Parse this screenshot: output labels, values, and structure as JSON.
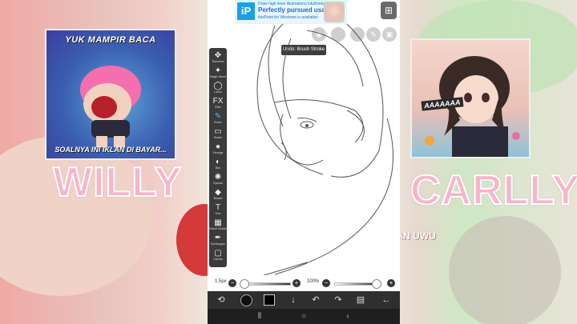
{
  "left_card": {
    "top_text": "YUK MAMPIR BACA",
    "bottom_text": "SOALNYA INI IKLAN DI BAYAR..."
  },
  "right_card": {
    "shout_text": "AAAAAAA"
  },
  "names": {
    "left": "WILLY",
    "right": "CARLLY"
  },
  "watermark": "@MUICAN UWU",
  "ad": {
    "logo_text": "iP",
    "line1": "Draw high level illustrations intuitively!",
    "line2": "Perfectly pursued usability!",
    "line3": "ibisPaint for Windows is available!"
  },
  "tooltip": "Undo: Brush Stroke",
  "tools": [
    {
      "icon": "✥",
      "label": "Transform"
    },
    {
      "icon": "✦",
      "label": "Magic Wand"
    },
    {
      "icon": "◯",
      "label": "Lasso"
    },
    {
      "icon": "FX",
      "label": "Filter"
    },
    {
      "icon": "✎",
      "label": "Brush"
    },
    {
      "icon": "▭",
      "label": "Eraser"
    },
    {
      "icon": "●",
      "label": "Smudge"
    },
    {
      "icon": "◐",
      "label": "Blur"
    },
    {
      "icon": "✺",
      "label": "Special"
    },
    {
      "icon": "◆",
      "label": "Bucket"
    },
    {
      "icon": "T",
      "label": "Text"
    },
    {
      "icon": "▦",
      "label": "Frame Divider"
    },
    {
      "icon": "✒",
      "label": "Eyedropper"
    },
    {
      "icon": "▢",
      "label": "Canvas"
    }
  ],
  "brush_size": "1.5px",
  "opacity": "100%",
  "colors": {
    "toolbar": "#3b3b3b",
    "accent": "#4fb3ff",
    "name_pink": "#f7b6c8"
  }
}
